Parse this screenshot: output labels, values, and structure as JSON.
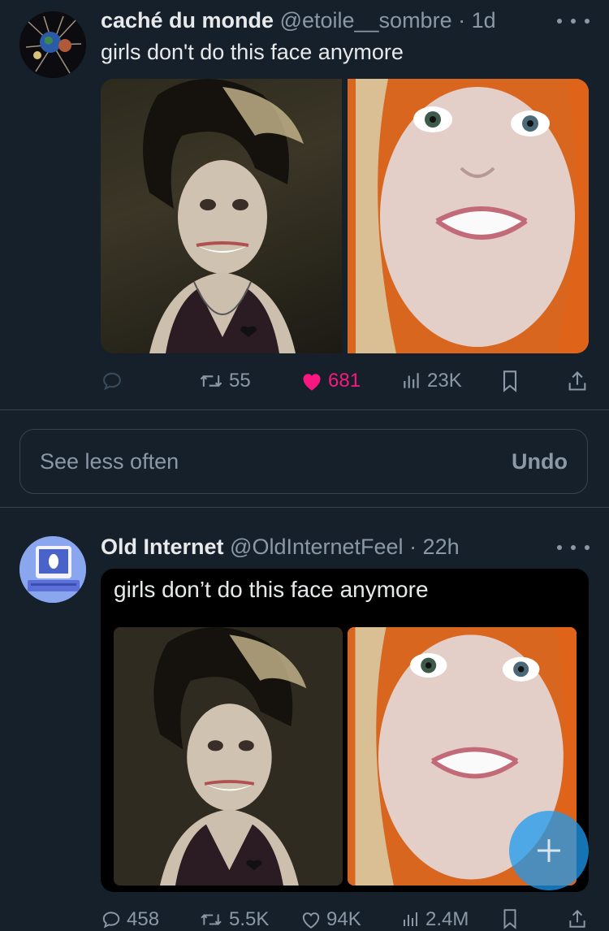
{
  "colors": {
    "background": "#15202b",
    "text_primary": "#e7e9ea",
    "text_secondary": "#8b98a5",
    "like_active": "#f91880",
    "divider": "#38444d",
    "fab": "#1d9bf0"
  },
  "tweet1": {
    "display_name": "caché du monde",
    "handle": "@etoile__sombre",
    "time": "· 1d",
    "text": "girls don't do this face anymore",
    "avatar_icon": "globe-artwork-avatar",
    "actions": {
      "reply_count": "",
      "retweet_count": "55",
      "like_count": "681",
      "like_active": true,
      "views_count": "23K"
    }
  },
  "feedback": {
    "text": "See less often",
    "undo_label": "Undo"
  },
  "tweet2": {
    "display_name": "Old Internet",
    "handle": "@OldInternetFeel",
    "time": "· 22h",
    "quote_caption": "girls don’t do this face anymore",
    "avatar_icon": "retro-computer-avatar",
    "actions": {
      "reply_count": "458",
      "retweet_count": "5.5K",
      "like_count": "94K",
      "views_count": "2.4M"
    }
  },
  "fab": {
    "icon": "plus-icon"
  }
}
